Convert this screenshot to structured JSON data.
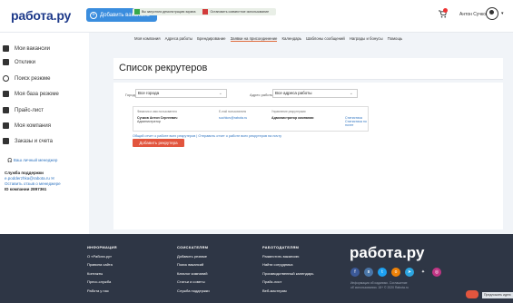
{
  "header": {
    "logo": "работа.ру",
    "add_vacancy": "Добавить вакансию",
    "notice_left": "Вы запустили демонстрацию экрана",
    "notice_right": "Остановить совместное использование",
    "user_name": "Антон Сучков",
    "user_caret": "▾"
  },
  "sidebar": {
    "items": [
      {
        "label": "Мои вакансии",
        "icon": "briefcase-icon"
      },
      {
        "label": "Отклики",
        "icon": "document-icon"
      },
      {
        "label": "Поиск резюме",
        "icon": "search-icon"
      },
      {
        "label": "Моя база резюме",
        "icon": "folder-icon"
      },
      {
        "label": "Прайс-лист",
        "icon": "price-icon"
      },
      {
        "label": "Моя компания",
        "icon": "building-icon"
      },
      {
        "label": "Заказы и счета",
        "icon": "invoice-icon"
      }
    ],
    "manager_link": "Ваш личный менеджер",
    "support_title": "Служба поддержки",
    "support_email": "e.podderzhka@rabota.ru",
    "support_feedback": "Оставить отзыв о менеджере",
    "company_id": "ID компании 2897361"
  },
  "tabs": [
    "Моя компания",
    "Адреса работы",
    "Брендирование",
    "Заявки на присоединение",
    "Календарь",
    "Шаблоны сообщений",
    "Награды и бонусы",
    "Помощь"
  ],
  "page": {
    "title": "Список рекрутеров",
    "city_label": "Город",
    "city_value": "Все города",
    "address_label": "Адрес работы",
    "address_value": "Все адреса работы"
  },
  "table": {
    "headers": [
      "Фамилия и имя пользователя",
      "E-mail пользователя",
      "Управление рекрутерами"
    ],
    "row": {
      "name": "Сучков Антон Сергеевич",
      "role": "Администратор",
      "email": "suchkov@rabota.ru",
      "permission": "Администратор компании",
      "link1": "Статистика",
      "link2": "Статистика по почте"
    }
  },
  "bottom_links": "Общий отчет о работе всех рекрутеров | Отправить отчет о работе всех рекрутеров на почту",
  "add_recruiter": "Добавить рекрутера",
  "footer": {
    "col1": {
      "head": "ИНФОРМАЦИЯ",
      "items": [
        "О «Работа.ру»",
        "Правила сайта",
        "Контакты",
        "Пресс-служба",
        "Работа у нас"
      ]
    },
    "col2": {
      "head": "СОИСКАТЕЛЯМ",
      "items": [
        "Добавить резюме",
        "Поиск вакансий",
        "Каталог компаний",
        "Статьи и советы",
        "Служба поддержки"
      ]
    },
    "col3": {
      "head": "РАБОТОДАТЕЛЯМ",
      "items": [
        "Разместить вакансию",
        "Найти сотрудника",
        "Производственный календарь",
        "Прайс-лист",
        "Веб-мастерам"
      ]
    },
    "logo": "работа.ру",
    "socials": [
      {
        "name": "facebook-icon",
        "glyph": "f",
        "color": "#3b5998"
      },
      {
        "name": "vk-icon",
        "glyph": "в",
        "color": "#4a76a8"
      },
      {
        "name": "twitter-icon",
        "glyph": "t",
        "color": "#1da1f2"
      },
      {
        "name": "ok-icon",
        "glyph": "о",
        "color": "#ee8208"
      },
      {
        "name": "telegram-icon",
        "glyph": "➤",
        "color": "#2ca5e0"
      },
      {
        "name": "sparkle-icon",
        "glyph": "✦",
        "color": "#2e3645"
      },
      {
        "name": "instagram-icon",
        "glyph": "◎",
        "color": "#c13584"
      }
    ],
    "copy_line1": "Информация об изданиях. Соглашение",
    "copy_line2": "об использовании. 18+ © 2020 Rabota.ru",
    "feedback": "Предложить идею"
  }
}
